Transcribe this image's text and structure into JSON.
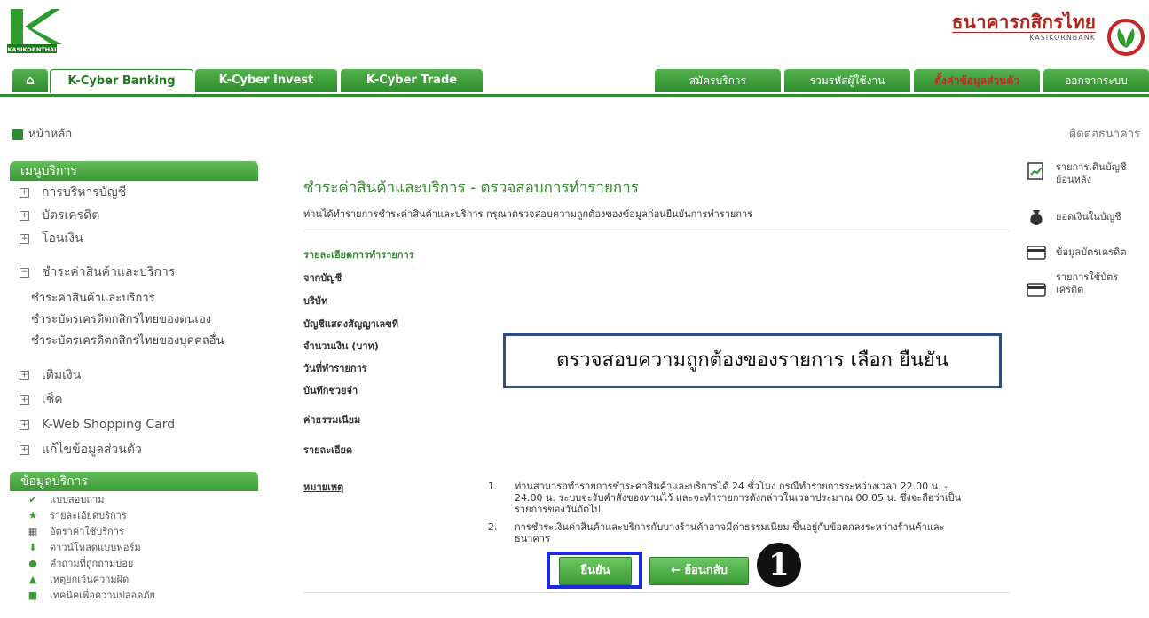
{
  "brand": {
    "logo_text": "KASIKORNTHAI",
    "bank_name_th": "ธนาคารกสิกรไทย",
    "bank_name_en": "KASIKORNBANK"
  },
  "nav": {
    "tabs": [
      "K-Cyber Banking",
      "K-Cyber Invest",
      "K-Cyber Trade"
    ],
    "right": [
      "สมัครบริการ",
      "รวมรหัสผู้ใช้งาน",
      "ตั้งค่าข้อมูลส่วนตัว",
      "ออกจากระบบ"
    ]
  },
  "subheader": {
    "home": "หน้าหลัก",
    "contact": "ติดต่อธนาคาร"
  },
  "sidebar": {
    "menu_title": "เมนูบริการ",
    "menu": [
      {
        "label": "การบริหารบัญชี",
        "sign": "⊞"
      },
      {
        "label": "บัตรเครดิต",
        "sign": "⊞"
      },
      {
        "label": "โอนเงิน",
        "sign": "⊞"
      },
      {
        "label": "ชำระค่าสินค้าและบริการ",
        "sign": "⊟"
      }
    ],
    "submenu": [
      "ชำระค่าสินค้าและบริการ",
      "ชำระบัตรเครดิตกสิกรไทยของตนเอง",
      "ชำระบัตรเครดิตกสิกรไทยของบุคคลอื่น"
    ],
    "menu2": [
      {
        "label": "เติมเงิน",
        "sign": "⊞"
      },
      {
        "label": "เช็ค",
        "sign": "⊞"
      },
      {
        "label": "K-Web Shopping Card",
        "sign": "⊞"
      },
      {
        "label": "แก้ไขข้อมูลส่วนตัว",
        "sign": "⊞"
      }
    ],
    "info_title": "ข้อมูลบริการ",
    "info": [
      "แบบสอบถาม",
      "รายละเอียดบริการ",
      "อัตราค่าใช้บริการ",
      "ดาวน์โหลดแบบฟอร์ม",
      "คำถามที่ถูกถามบ่อย",
      "เหตุยกเว้นความผิด",
      "เทคนิคเพื่อความปลอดภัย"
    ]
  },
  "main": {
    "title": "ชำระค่าสินค้าและบริการ - ตรวจสอบการทำรายการ",
    "description": "ท่านได้ทำรายการชำระค่าสินค้าและบริการ กรุณาตรวจสอบความถูกต้องของข้อมูลก่อนยืนยันการทำรายการ",
    "section": "รายละเอียดการทำรายการ",
    "fields": [
      "จากบัญชี",
      "บริษัท",
      "บัญชีแสดงสัญญาเลขที่",
      "จำนวนเงิน (บาท)",
      "วันที่ทำรายการ",
      "บันทึกช่วยจำ",
      "ค่าธรรมเนียม",
      "รายละเอียด"
    ],
    "notes_label": "หมายเหตุ",
    "notes": [
      {
        "num": "1.",
        "text": "ท่านสามารถทำรายการชำระค่าสินค้าและบริการได้ 24 ชั่วโมง กรณีทำรายการระหว่างเวลา 22.00 น. - 24.00 น. ระบบจะรับคำสั่งของท่านไว้ และจะทำรายการดังกล่าวในเวลาประมาณ 00.05 น. ซึ่งจะถือว่าเป็นรายการของวันถัดไป"
      },
      {
        "num": "2.",
        "text": "การชำระเงินค่าสินค้าและบริการกับบางร้านค้าอาจมีค่าธรรมเนียม ขึ้นอยู่กับข้อตกลงระหว่างร้านค้าและธนาคาร"
      }
    ],
    "confirm": "ยืนยัน",
    "back": "← ย้อนกลับ",
    "callout": "ตรวจสอบความถูกต้องของรายการ เลือก ยืนยัน",
    "step": "1"
  },
  "shortcuts": [
    "รายการเดินบัญชีย้อนหลัง",
    "ยอดเงินในบัญชี",
    "ข้อมูลบัตรเครดิต",
    "รายการใช้บัตรเครดิต"
  ],
  "colors": {
    "brand_green": "#2e8b2e",
    "brand_red": "#b3261e",
    "highlight_blue": "#1b2bd8"
  }
}
